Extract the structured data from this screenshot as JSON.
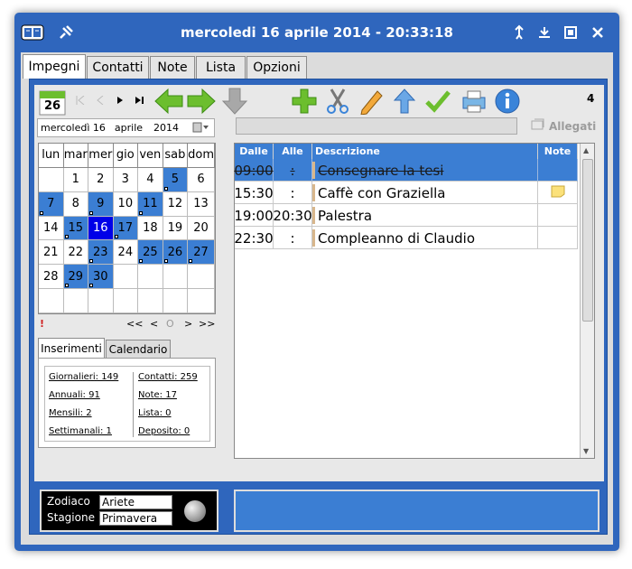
{
  "window": {
    "title": "mercoledi 16 aprile 2014 - 20:33:18"
  },
  "tabs": [
    {
      "label": "Impegni"
    },
    {
      "label": "Contatti"
    },
    {
      "label": "Note"
    },
    {
      "label": "Lista"
    },
    {
      "label": "Opzioni"
    }
  ],
  "toolbar": {
    "calendar_day": "26",
    "count": "4"
  },
  "date_field": {
    "day": "mercoledì 16",
    "month": "aprile",
    "year": "2014"
  },
  "attachments": {
    "label": "Allegati"
  },
  "calendar": {
    "headers": [
      "lun",
      "mar",
      "mer",
      "gio",
      "ven",
      "sab",
      "dom"
    ],
    "weeks": [
      [
        "",
        "1",
        "2",
        "3",
        "4",
        "5",
        "6"
      ],
      [
        "7",
        "8",
        "9",
        "10",
        "11",
        "12",
        "13"
      ],
      [
        "14",
        "15",
        "16",
        "17",
        "18",
        "19",
        "20"
      ],
      [
        "21",
        "22",
        "23",
        "24",
        "25",
        "26",
        "27"
      ],
      [
        "28",
        "29",
        "30",
        "",
        "",
        "",
        ""
      ],
      [
        "",
        "",
        "",
        "",
        "",
        "",
        ""
      ]
    ],
    "marked_days": [
      "5",
      "7",
      "9",
      "11",
      "15",
      "17",
      "23",
      "25",
      "26",
      "27",
      "29",
      "30"
    ],
    "today": "16",
    "nav": {
      "alert": "!",
      "first": "<<",
      "prev": "<",
      "current": "O",
      "next": ">",
      "last": ">>"
    }
  },
  "subtabs": [
    {
      "label": "Inserimenti"
    },
    {
      "label": "Calendario"
    }
  ],
  "stats": {
    "left": [
      "Giornalieri: 149",
      "Annuali: 91",
      "Mensili: 2",
      "Settimanali: 1"
    ],
    "right": [
      "Contatti: 259",
      "Note: 17",
      "Lista: 0",
      "Deposito: 0"
    ]
  },
  "table": {
    "headers": [
      "Dalle",
      "Alle",
      "Descrizione",
      "Note"
    ],
    "rows": [
      {
        "from": "09:00",
        "to": ":",
        "description": "Consegnare la tesi",
        "selected": true
      },
      {
        "from": "15:30",
        "to": ":",
        "description": "Caffè con Graziella",
        "note": true
      },
      {
        "from": "19:00",
        "to": "20:30",
        "description": "Palestra"
      },
      {
        "from": "22:30",
        "to": ":",
        "description": "Compleanno di Claudio"
      }
    ]
  },
  "zodiac": {
    "zodiac_label": "Zodiaco",
    "zodiac_value": "Ariete",
    "season_label": "Stagione",
    "season_value": "Primavera"
  },
  "colors": {
    "accent": "#2f66bd",
    "selection": "#3b7ed3",
    "today": "#0000e8"
  }
}
